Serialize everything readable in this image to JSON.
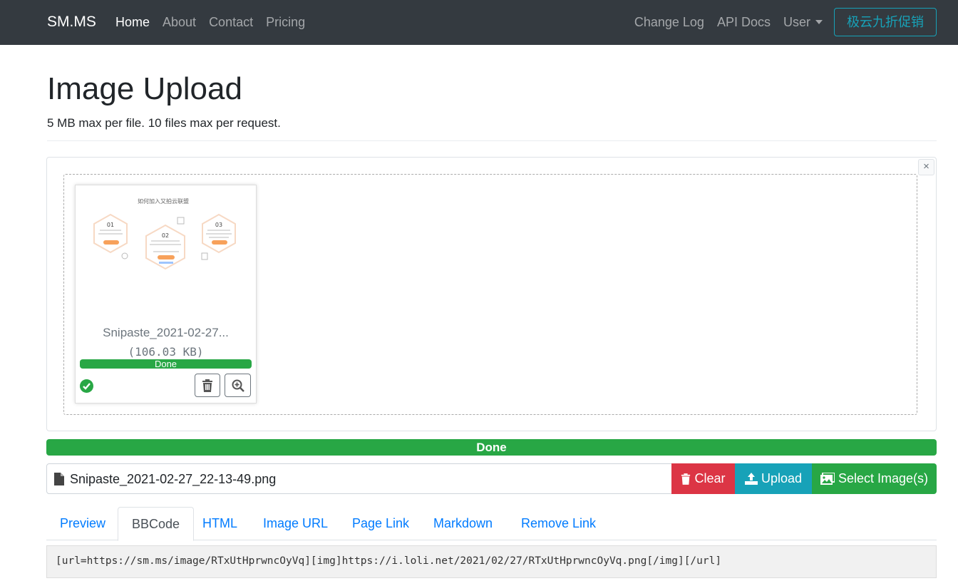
{
  "nav": {
    "brand": "SM.MS",
    "left": [
      "Home",
      "About",
      "Contact",
      "Pricing"
    ],
    "right": [
      "Change Log",
      "API Docs",
      "User"
    ],
    "promo": "极云九折促销"
  },
  "header": {
    "title": "Image Upload",
    "subtitle": "5 MB max per file. 10 files max per request."
  },
  "thumb": {
    "image_title": "如何加入又拍云联盟",
    "steps": [
      "01",
      "02",
      "03"
    ],
    "name": "Snipaste_2021-02-27...",
    "size": "(106.03 KB)",
    "status": "Done",
    "progress": 1.0
  },
  "close_label": "×",
  "main_progress": {
    "label": "Done",
    "progress": 1.0
  },
  "file_input": {
    "value": "Snipaste_2021-02-27_22-13-49.png"
  },
  "buttons": {
    "clear": "Clear",
    "upload": "Upload",
    "select": "Select Image(s)"
  },
  "tabs": [
    "Preview",
    "BBCode",
    "HTML",
    "Image URL",
    "Page Link",
    "Markdown",
    "Remove Link"
  ],
  "active_tab": "BBCode",
  "code": "[url=https://sm.ms/image/RTxUtHprwncOyVq][img]https://i.loli.net/2021/02/27/RTxUtHprwncOyVq.png[/img][/url]",
  "colors": {
    "navbar": "#343a40",
    "success": "#28a745",
    "danger": "#dc3545",
    "info": "#17a2b8",
    "link": "#007bff"
  }
}
